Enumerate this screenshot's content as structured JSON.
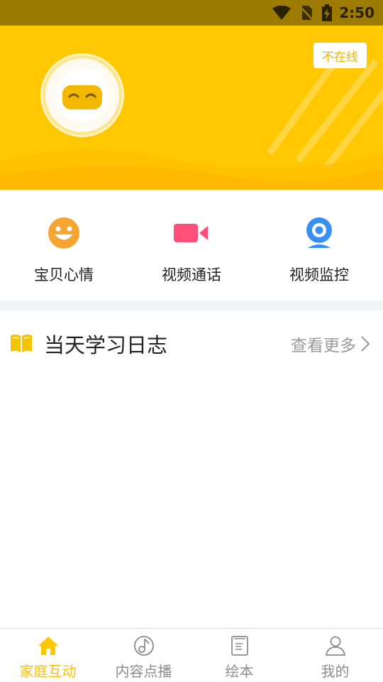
{
  "status_bar": {
    "time": "2:50"
  },
  "header": {
    "online_status": "不在线"
  },
  "actions": [
    {
      "label": "宝贝心情",
      "icon": "smiley-face-icon"
    },
    {
      "label": "视频通话",
      "icon": "video-camera-icon"
    },
    {
      "label": "视频监控",
      "icon": "webcam-icon"
    }
  ],
  "section": {
    "title": "当天学习日志",
    "more": "查看更多"
  },
  "bottom_nav": [
    {
      "label": "家庭互动",
      "icon": "home-icon",
      "active": true
    },
    {
      "label": "内容点播",
      "icon": "music-note-icon",
      "active": false
    },
    {
      "label": "绘本",
      "icon": "picture-book-icon",
      "active": false
    },
    {
      "label": "我的",
      "icon": "profile-icon",
      "active": false
    }
  ],
  "colors": {
    "brand": "#ffc800",
    "accent_text": "#ffbf00",
    "status_bar": "#9c7b00"
  }
}
